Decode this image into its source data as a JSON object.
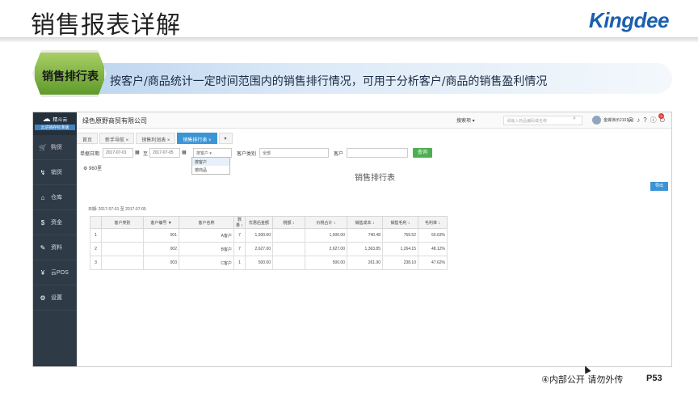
{
  "slide": {
    "title": "销售报表详解",
    "brand": "Kingdee",
    "badge": "销售排行表",
    "banner": "按客户/商品统计一定时间范围内的销售排行情况，可用于分析客户/商品的销售盈利情况",
    "footer_note": "④内部公开 请勿外传",
    "page": "P53"
  },
  "app": {
    "logo": {
      "name": "精斗云",
      "sub": "云进销存标准版"
    },
    "company": "绿色原野商贸有限公司",
    "search_scope": "搜索项 ▾",
    "search_placeholder": "请输入商品编码或名称",
    "user": "金蝶演示2101 ▾",
    "notif_count": "9",
    "sidebar": [
      {
        "icon": "🛒",
        "label": "购货"
      },
      {
        "icon": "↯",
        "label": "销货"
      },
      {
        "icon": "⌂",
        "label": "仓库"
      },
      {
        "icon": "$",
        "label": "资金"
      },
      {
        "icon": "✎",
        "label": "资料"
      },
      {
        "icon": "¥",
        "label": "云POS"
      },
      {
        "icon": "⚙",
        "label": "设置"
      }
    ],
    "tabs": [
      "首页",
      "新手导航 ×",
      "销售利润表 ×",
      "销售排行表 ×",
      "▾"
    ],
    "filters": {
      "date_label": "单据日期",
      "date_from": "2017-07-01",
      "date_to_label": "至",
      "date_to": "2017-07-05",
      "group_by": "按客户",
      "customer_type_label": "客户类别",
      "customer_type_value": "全部",
      "customer_label": "客户",
      "query_button": "查询"
    },
    "dropdown_options": [
      "按客户",
      "按商品"
    ],
    "scheme": "⚙ 960里",
    "report_title": "销售排行表",
    "export_button": "导出",
    "date_range": "日期: 2017-07-01 至 2017-07-05",
    "table": {
      "headers": [
        "",
        "客户类别",
        "客户编号 ▼",
        "客户名称",
        "数量 ↕",
        "优惠后金额",
        "税额 ↕",
        "价税合计 ↕",
        "销售成本 ↕",
        "销售毛利 ↕",
        "毛利率 ↕"
      ],
      "rows": [
        [
          "1",
          "",
          "001",
          "A客户",
          "7",
          "1,500.00",
          "",
          "1,500.00",
          "740.48",
          "759.52",
          "50.63%"
        ],
        [
          "2",
          "",
          "002",
          "B客户",
          "7",
          "2,627.00",
          "",
          "2,627.00",
          "1,363.85",
          "1,264.15",
          "48.12%"
        ],
        [
          "3",
          "",
          "003",
          "C客户",
          "1",
          "500.00",
          "",
          "500.00",
          "261.90",
          "238.10",
          "47.62%"
        ]
      ]
    }
  }
}
